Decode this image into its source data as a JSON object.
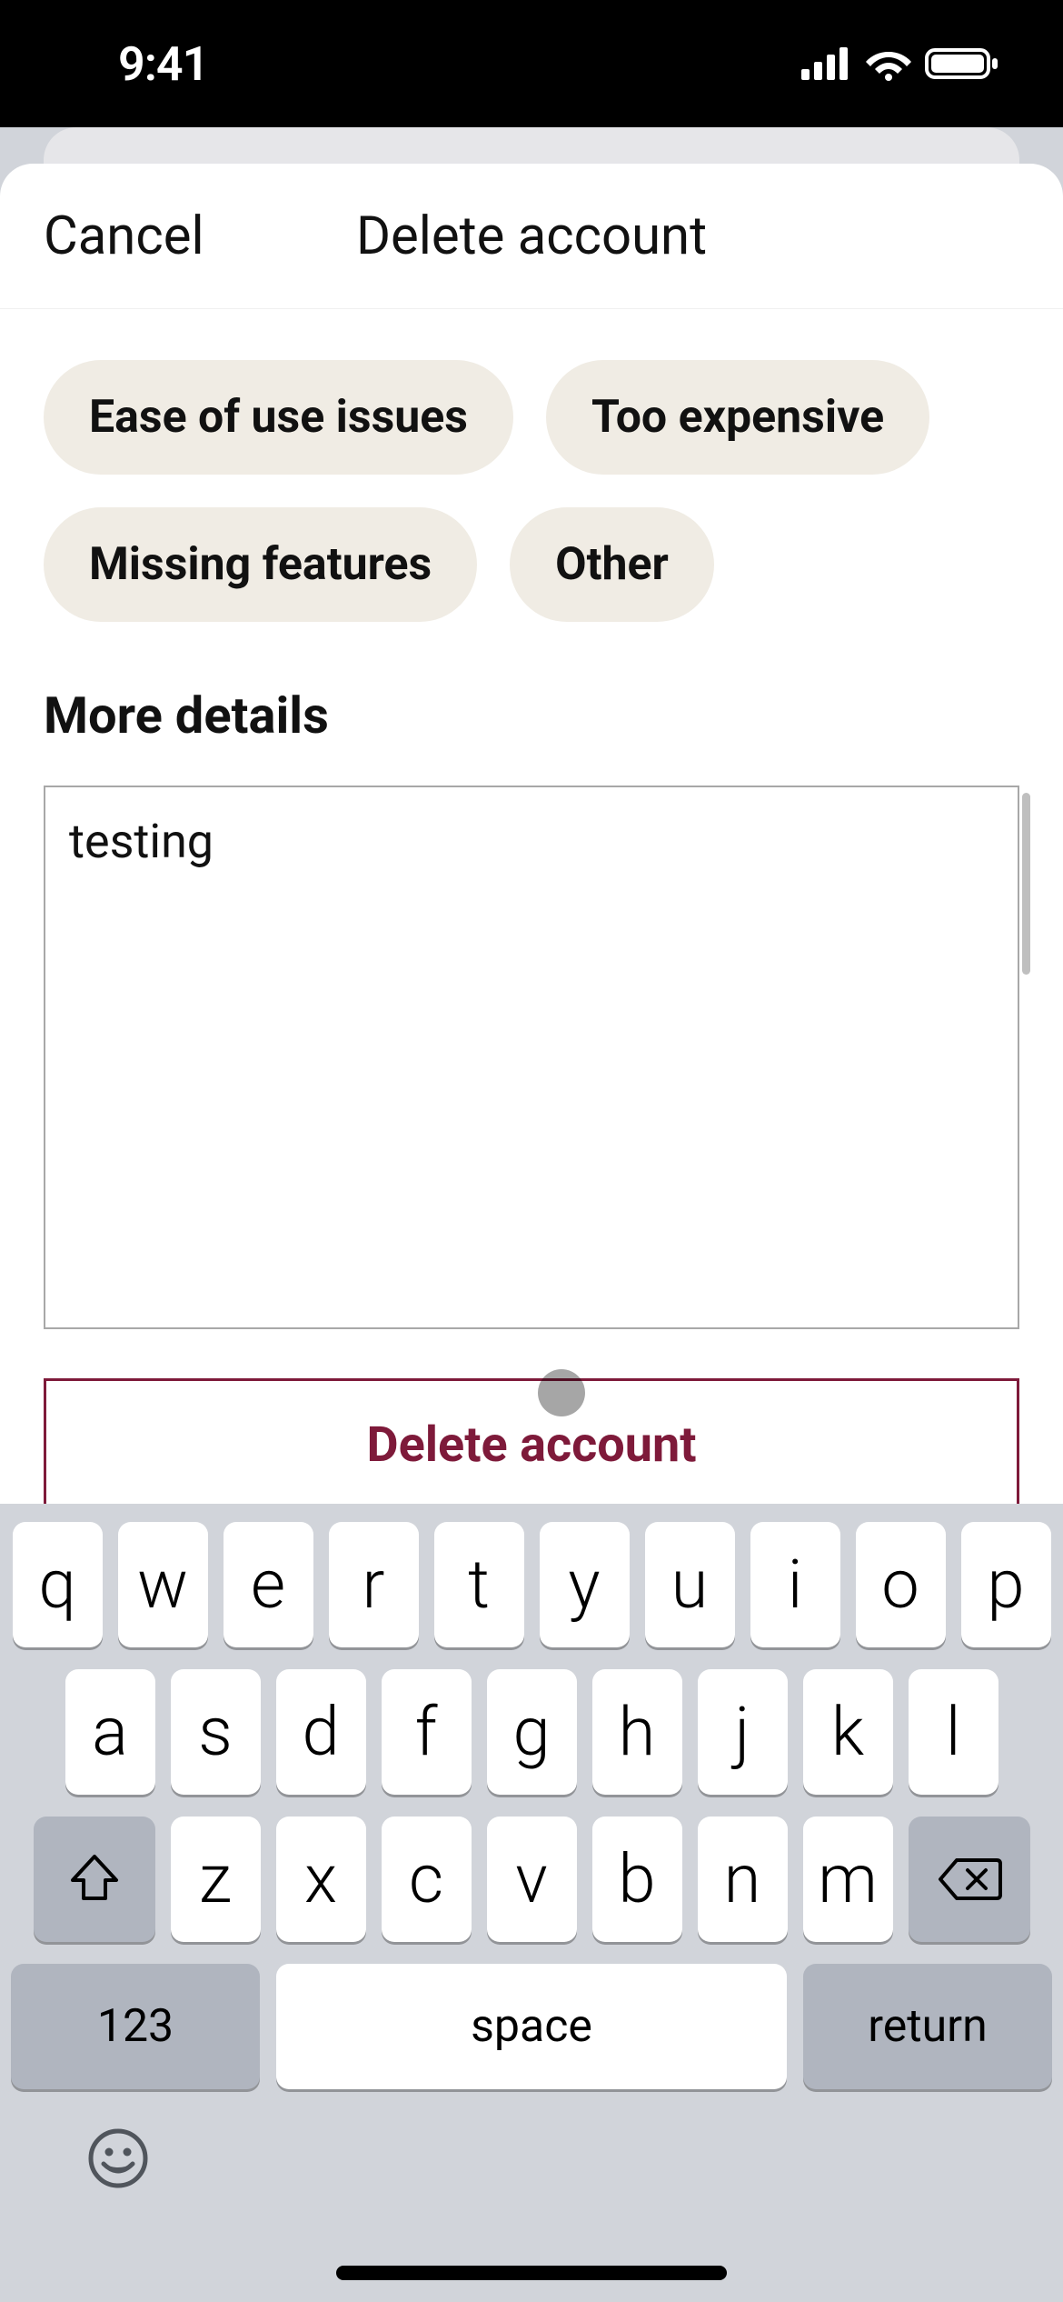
{
  "status": {
    "time": "9:41"
  },
  "nav": {
    "cancel_label": "Cancel",
    "title": "Delete account"
  },
  "chips": [
    "Ease of use issues",
    "Too expensive",
    "Missing features",
    "Other"
  ],
  "details": {
    "label": "More details",
    "value": "testing\n"
  },
  "actions": {
    "delete_label": "Delete account"
  },
  "keyboard": {
    "row1": [
      "q",
      "w",
      "e",
      "r",
      "t",
      "y",
      "u",
      "i",
      "o",
      "p"
    ],
    "row2": [
      "a",
      "s",
      "d",
      "f",
      "g",
      "h",
      "j",
      "k",
      "l"
    ],
    "row3": [
      "z",
      "x",
      "c",
      "v",
      "b",
      "n",
      "m"
    ],
    "numbers_label": "123",
    "space_label": "space",
    "return_label": "return"
  }
}
